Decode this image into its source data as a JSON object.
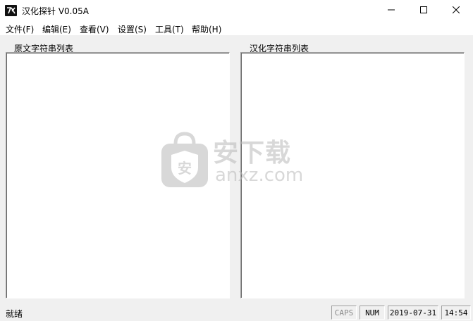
{
  "window": {
    "title": "汉化探针  V0.05A",
    "icon": "app-logo-icon",
    "controls": {
      "minimize": "minimize-icon",
      "maximize": "maximize-icon",
      "close": "close-icon"
    }
  },
  "menu": {
    "items": [
      {
        "label": "文件(F)"
      },
      {
        "label": "编辑(E)"
      },
      {
        "label": "查看(V)"
      },
      {
        "label": "设置(S)"
      },
      {
        "label": "工具(T)"
      },
      {
        "label": "帮助(H)"
      }
    ]
  },
  "panels": {
    "left_label": "原文字符串列表",
    "right_label": "汉化字符串列表"
  },
  "watermark": {
    "text_cn": "安下载",
    "text_en": "anxz.com",
    "shield_char": "安",
    "icon": "shield-bag-icon"
  },
  "status": {
    "text": "就绪",
    "caps": "CAPS",
    "num": "NUM",
    "date": "2019-07-31",
    "time": "14:54"
  },
  "colors": {
    "client_bg": "#f0f0f0",
    "list_bg": "#ffffff",
    "border": "#a0a0a0"
  }
}
